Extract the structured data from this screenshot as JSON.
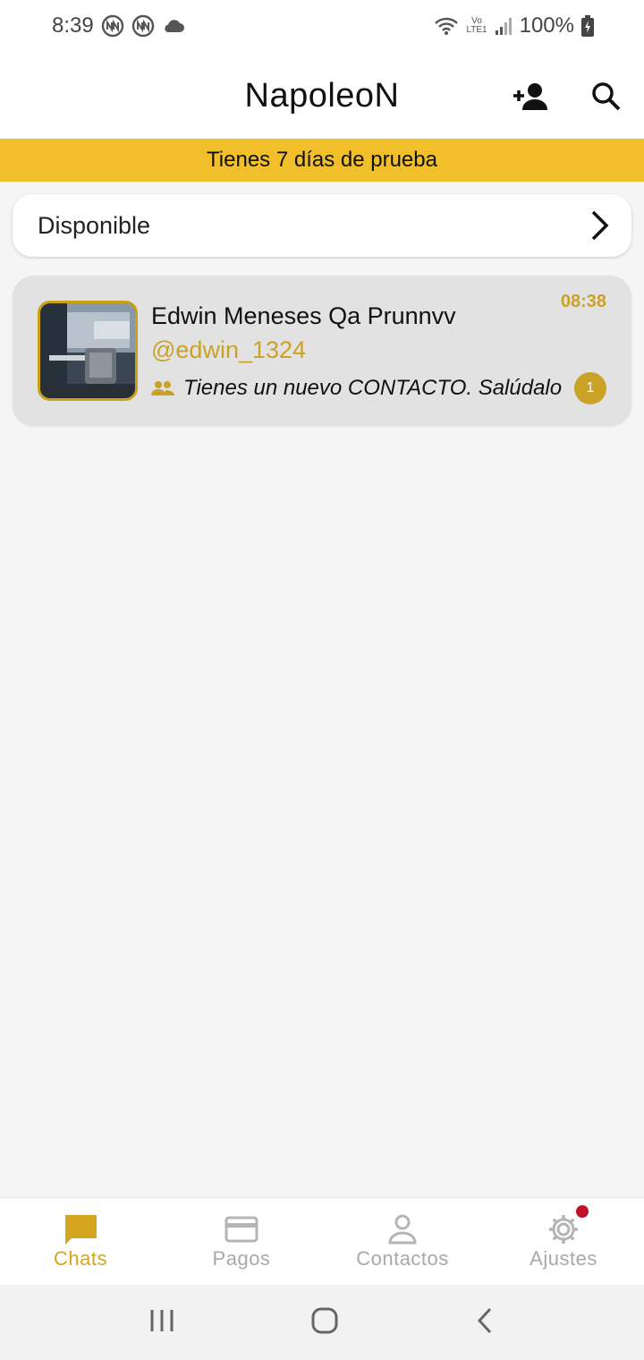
{
  "status_bar": {
    "time": "8:39",
    "battery": "100%",
    "network": "LTE1"
  },
  "app_bar": {
    "title": "NapoleoN"
  },
  "trial_banner": {
    "text": "Tienes 7 días de prueba"
  },
  "status_card": {
    "label": "Disponible"
  },
  "chats": [
    {
      "name": "Edwin Meneses Qa Prunnvv",
      "handle": "@edwin_1324",
      "preview": "Tienes un nuevo CONTACTO. Salúdalo",
      "time": "08:38",
      "unread": "1"
    }
  ],
  "bottom_nav": {
    "items": [
      {
        "label": "Chats",
        "icon": "chat-icon",
        "active": true
      },
      {
        "label": "Pagos",
        "icon": "card-icon",
        "active": false
      },
      {
        "label": "Contactos",
        "icon": "person-icon",
        "active": false
      },
      {
        "label": "Ajustes",
        "icon": "gear-icon",
        "active": false
      }
    ]
  },
  "colors": {
    "accent": "#f0bf2a",
    "gold_text": "#c9a227",
    "notification_dot": "#c0102a"
  }
}
